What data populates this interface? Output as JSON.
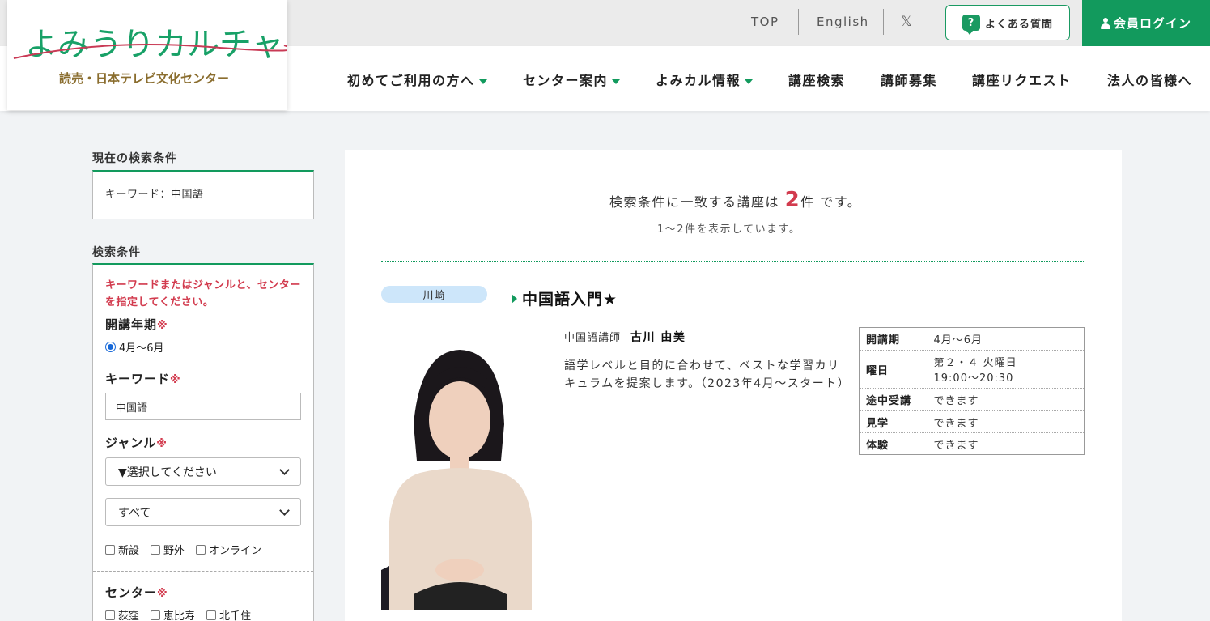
{
  "logo": {
    "name": "よみうりカルチャー",
    "subtitle": "読売・日本テレビ文化センター"
  },
  "header": {
    "top_link": "TOP",
    "english_link": "English",
    "x_icon": "𝕏",
    "faq_label": "よくある質問",
    "login_label": "会員ログイン",
    "accent": "#129a5d"
  },
  "nav": [
    {
      "label": "初めてご利用の方へ",
      "has_caret": true
    },
    {
      "label": "センター案内",
      "has_caret": true
    },
    {
      "label": "よみカル情報",
      "has_caret": true
    },
    {
      "label": "講座検索",
      "has_caret": false
    },
    {
      "label": "講師募集",
      "has_caret": false
    },
    {
      "label": "講座リクエスト",
      "has_caret": false
    },
    {
      "label": "法人の皆様へ",
      "has_caret": false
    }
  ],
  "sidebar": {
    "current_heading": "現在の検索条件",
    "current_condition": "キーワード：中国語",
    "search_heading": "検索条件",
    "warning": "キーワードまたはジャンルと、センターを指定してください。",
    "period_label": "開講年期",
    "required_mark": "※",
    "period_option": "4月〜6月",
    "keyword_label": "キーワード",
    "keyword_value": "中国語",
    "genre_label": "ジャンル",
    "genre_select": "▼選択してください",
    "subgenre_select": "すべて",
    "checks": [
      "新設",
      "野外",
      "オンライン"
    ],
    "center_label": "センター",
    "centers": [
      "荻窪",
      "恵比寿",
      "北千住"
    ]
  },
  "results": {
    "prefix": "検索条件に一致する講座は",
    "count": "2",
    "suffix": "件 です。",
    "showing": "1〜2件を表示しています。"
  },
  "course": {
    "center": "川崎",
    "title": "中国語入門★",
    "teacher_role": "中国語講師",
    "teacher_name": "古川 由美",
    "description": "語学レベルと目的に合わせて、ベストな学習カリキュラムを提案します。（2023年4月〜スタート）",
    "info": [
      {
        "k": "開講期",
        "v": "4月〜6月"
      },
      {
        "k": "曜日",
        "v": "第２・４ 火曜日",
        "v2": "19:00〜20:30"
      },
      {
        "k": "途中受講",
        "v": "できます"
      },
      {
        "k": "見学",
        "v": "できます"
      },
      {
        "k": "体験",
        "v": "できます"
      }
    ]
  }
}
